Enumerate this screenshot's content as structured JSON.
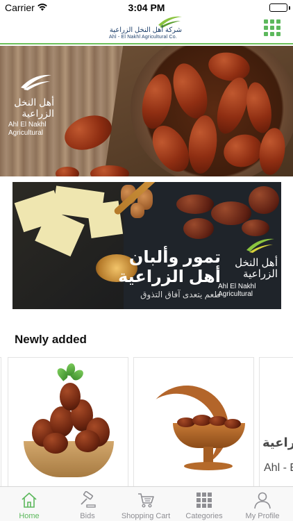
{
  "status_bar": {
    "carrier": "Carrier",
    "time": "3:04 PM",
    "battery_level": 1.0
  },
  "header": {
    "brand_ar": "شركة أهل النخل الزراعية",
    "brand_en": "Ahl - El Nakhl Agricultural Co.",
    "menu_icon": "grid-icon",
    "accent_color": "#5cb85c"
  },
  "hero_banner": {
    "logo_ar": "أهل النخل الزراعية",
    "logo_en": "Ahl El Nakhl Agricultural"
  },
  "promo_banner": {
    "headline_line1": "تمور وألبان",
    "headline_line2": "أهل الزراعية",
    "tagline": "طعم يتعدى آفاق التذوق",
    "logo_ar": "أهل النخل الزراعية",
    "logo_en": "Ahl El Nakhl Agricultural"
  },
  "newly_added": {
    "title": "Newly added",
    "card3_ar": "الزراعية",
    "card3_en": "Ahl - El"
  },
  "tab_bar": {
    "tabs": [
      {
        "label": "Home",
        "icon": "home-icon",
        "active": true
      },
      {
        "label": "Bids",
        "icon": "gavel-icon",
        "active": false
      },
      {
        "label": "Shopping Cart",
        "icon": "cart-icon",
        "active": false
      },
      {
        "label": "Categories",
        "icon": "grid-icon",
        "active": false
      },
      {
        "label": "My Profile",
        "icon": "profile-icon",
        "active": false
      }
    ],
    "active_color": "#5cb85c",
    "inactive_color": "#8e8e93"
  }
}
